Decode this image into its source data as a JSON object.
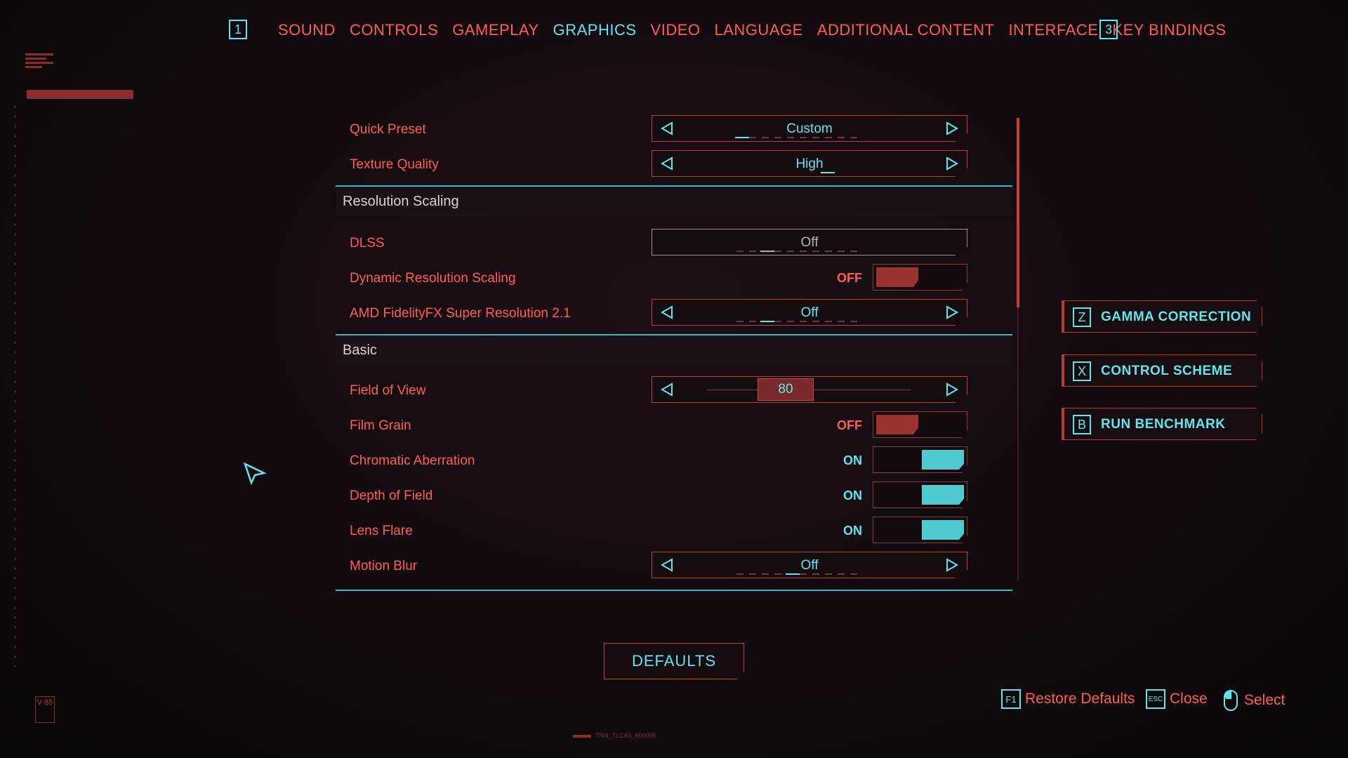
{
  "nav": {
    "left_key": "1",
    "right_key": "3",
    "tabs": [
      {
        "label": "SOUND",
        "active": false
      },
      {
        "label": "CONTROLS",
        "active": false
      },
      {
        "label": "GAMEPLAY",
        "active": false
      },
      {
        "label": "GRAPHICS",
        "active": true
      },
      {
        "label": "VIDEO",
        "active": false
      },
      {
        "label": "LANGUAGE",
        "active": false
      },
      {
        "label": "ADDITIONAL CONTENT",
        "active": false
      },
      {
        "label": "INTERFACE",
        "active": false
      },
      {
        "label": "KEY BINDINGS",
        "active": false
      }
    ]
  },
  "settings": {
    "quick_preset": {
      "label": "Quick Preset",
      "value": "Custom"
    },
    "texture_quality": {
      "label": "Texture Quality",
      "value": "High"
    },
    "section_resolution": "Resolution Scaling",
    "dlss": {
      "label": "DLSS",
      "value": "Off"
    },
    "dynamic_res": {
      "label": "Dynamic Resolution Scaling",
      "state": "OFF"
    },
    "amd_fsr": {
      "label": "AMD FidelityFX Super Resolution 2.1",
      "value": "Off"
    },
    "section_basic": "Basic",
    "fov": {
      "label": "Field of View",
      "value": "80"
    },
    "film_grain": {
      "label": "Film Grain",
      "state": "OFF"
    },
    "chromatic_aberration": {
      "label": "Chromatic Aberration",
      "state": "ON"
    },
    "depth_of_field": {
      "label": "Depth of Field",
      "state": "ON"
    },
    "lens_flare": {
      "label": "Lens Flare",
      "state": "ON"
    },
    "motion_blur": {
      "label": "Motion Blur",
      "value": "Off"
    }
  },
  "side_buttons": {
    "gamma": {
      "key": "Z",
      "label": "GAMMA CORRECTION"
    },
    "control_scheme": {
      "key": "X",
      "label": "CONTROL SCHEME"
    },
    "benchmark": {
      "key": "B",
      "label": "RUN BENCHMARK"
    }
  },
  "defaults_label": "DEFAULTS",
  "footer": {
    "restore": {
      "key": "F1",
      "label": "Restore Defaults"
    },
    "close": {
      "key": "ESC",
      "label": "Close"
    },
    "select": {
      "label": "Select"
    }
  },
  "deco": {
    "v_badge": "V 85",
    "bottom_tag": "TRN_TLCA5_800095"
  },
  "colors": {
    "accent_cyan": "#5fe7ee",
    "accent_red": "#ff5e57",
    "background": "#140b10"
  },
  "icons": {
    "arrow_left": "triangle-left-icon",
    "arrow_right": "triangle-right-icon",
    "mouse": "mouse-icon",
    "cursor": "pointer-cursor-icon"
  }
}
